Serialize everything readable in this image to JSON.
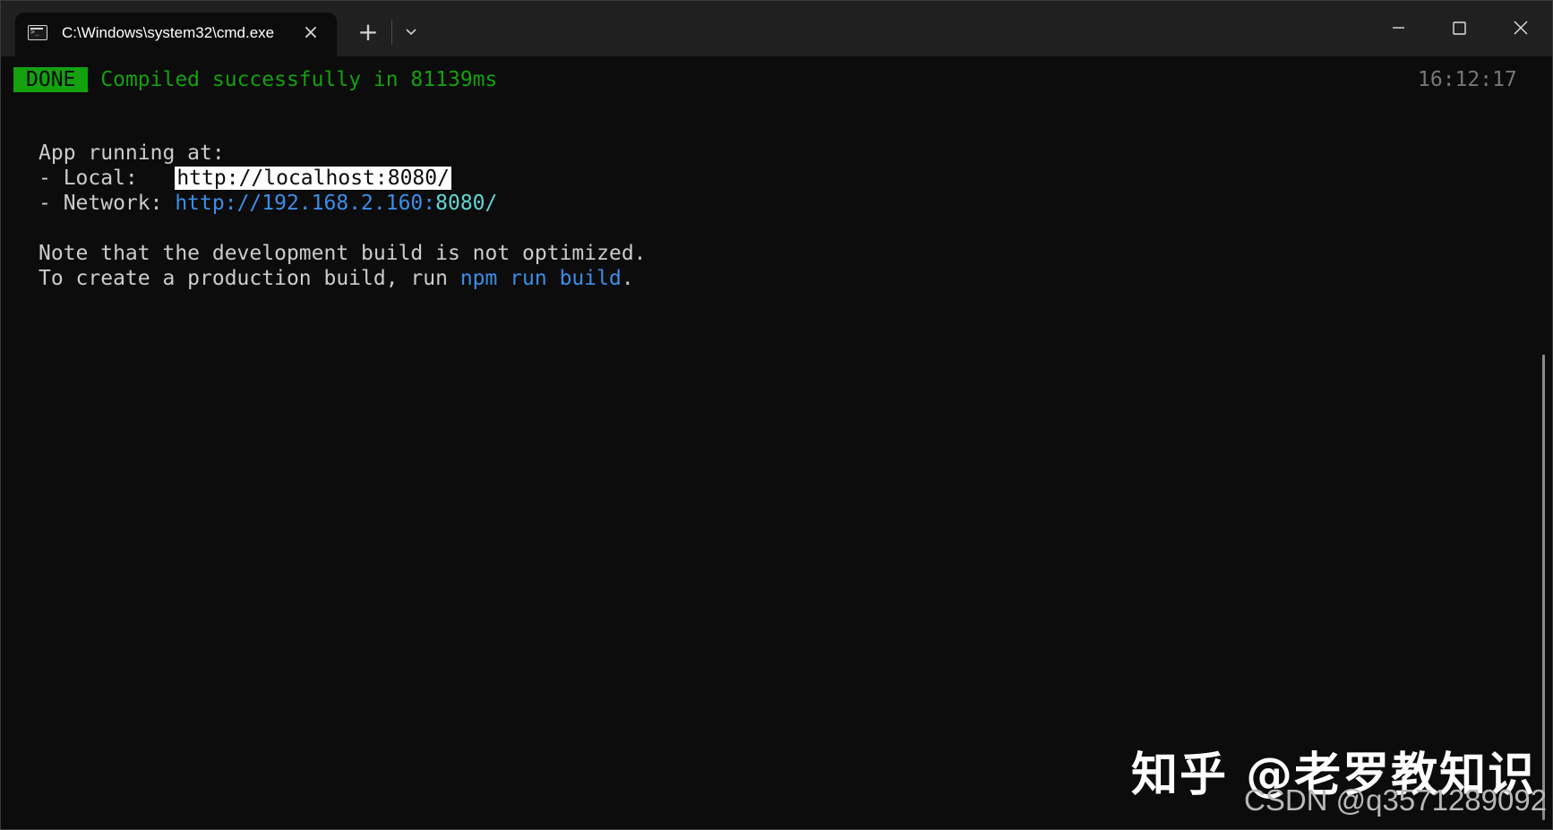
{
  "window": {
    "tab_title": "C:\\Windows\\system32\\cmd.exe",
    "tab_icon": "terminal-icon",
    "close_tab_icon": "close-icon",
    "new_tab_label": "+",
    "dropdown_icon": "chevron-down-icon",
    "controls": [
      "minimize-icon",
      "maximize-icon",
      "close-icon"
    ]
  },
  "terminal": {
    "done_badge": "DONE",
    "compile_message": "Compiled successfully in 81139ms",
    "timestamp": "16:12:17",
    "app_running": "App running at:",
    "local_prefix": "- Local:   ",
    "local_url": "http://localhost:8080/",
    "network_prefix": "- Network: ",
    "network_url_host": "http://192.168.2.160:",
    "network_url_port": "8080/",
    "note_line": "Note that the development build is not optimized.",
    "prod_prefix": "To create a production build, run ",
    "prod_command": "npm run build",
    "prod_suffix": "."
  },
  "watermark": {
    "zhihu": "知乎 @老罗教知识",
    "csdn": "CSDN @q3571289092"
  },
  "colors": {
    "background": "#0c0c0c",
    "titlebar": "#202020",
    "green": "#13a10e",
    "link_blue": "#3b8eea",
    "timestamp_gray": "#767676",
    "text": "#cccccc"
  }
}
